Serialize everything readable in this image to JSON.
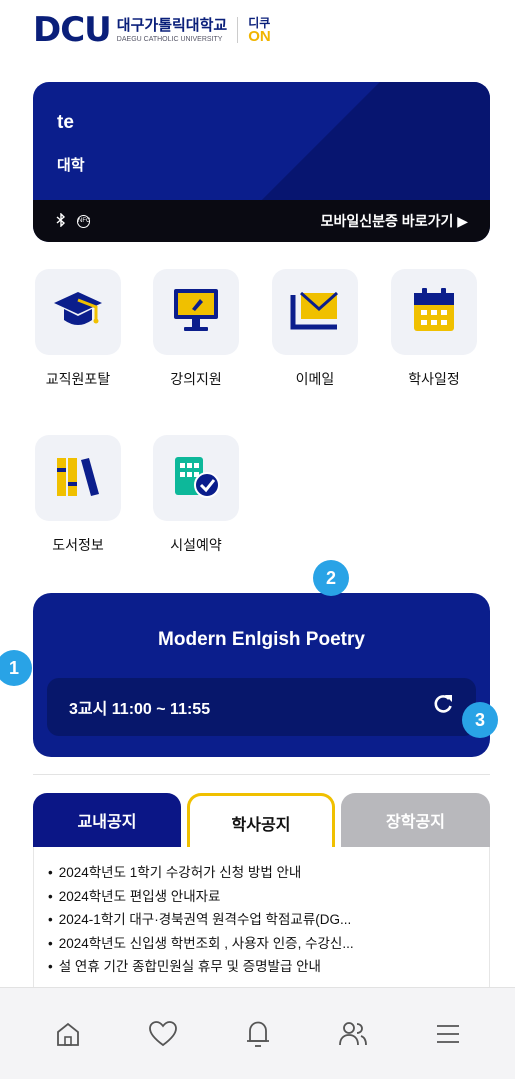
{
  "header": {
    "logo_main": "DCU",
    "logo_korean": "대구가톨릭대학교",
    "logo_english": "DAEGU CATHOLIC UNIVERSITY",
    "logo_on_top": "디쿠",
    "logo_on_bottom": "ON"
  },
  "id_card": {
    "name": "te",
    "department": "대학",
    "bluetooth_icon": "bluetooth-icon",
    "nfc_icon": "nfc-icon",
    "mobile_id_link": "모바일신분증 바로가기 ▶"
  },
  "apps": [
    {
      "label": "교직원포탈",
      "icon": "graduation-cap-icon"
    },
    {
      "label": "강의지원",
      "icon": "monitor-pen-icon"
    },
    {
      "label": "이메일",
      "icon": "mail-icon"
    },
    {
      "label": "학사일정",
      "icon": "calendar-icon"
    },
    {
      "label": "도서정보",
      "icon": "books-icon"
    },
    {
      "label": "시설예약",
      "icon": "building-check-icon"
    }
  ],
  "badges": [
    "1",
    "2",
    "3"
  ],
  "class_card": {
    "title": "Modern Enlgish Poetry",
    "time": "3교시 11:00 ~ 11:55",
    "refresh": "C"
  },
  "notice_tabs": [
    "교내공지",
    "학사공지",
    "장학공지"
  ],
  "notices": [
    "2024학년도 1학기 수강허가 신청 방법 안내",
    "2024학년도 편입생 안내자료",
    "2024-1학기 대구·경북권역 원격수업 학점교류(DG...",
    "2024학년도 신입생 학번조회 , 사용자 인증, 수강신...",
    "설 연휴 기간 종합민원실 휴무 및 증명발급 안내"
  ],
  "colors": {
    "primary_navy": "#0b1e8c",
    "accent_yellow": "#f0c000",
    "badge_blue": "#29a3e6"
  },
  "bottom_nav": [
    "home-icon",
    "heart-icon",
    "bell-icon",
    "people-icon",
    "menu-icon"
  ]
}
